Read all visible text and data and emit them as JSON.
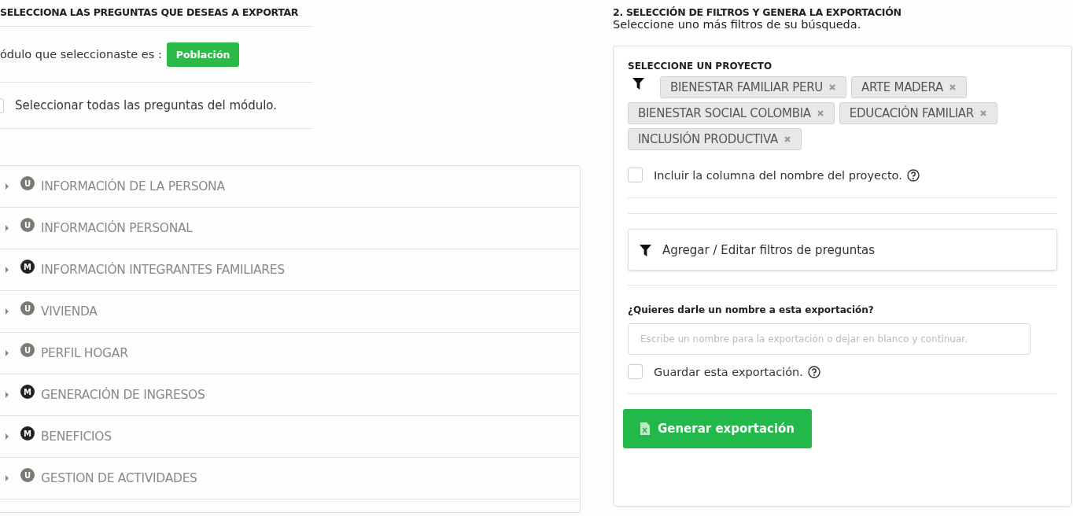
{
  "left": {
    "heading": "SELECCIONA LAS PREGUNTAS QUE DESEAS A EXPORTAR",
    "module_label": "ódulo que seleccionaste es :",
    "module_badge": "Población",
    "select_all": {
      "label": "Seleccionar todas las preguntas del módulo.",
      "checked": false
    },
    "sections": [
      {
        "badge": "U",
        "color": "#7a7a72",
        "title": "INFORMACIÓN DE LA PERSONA",
        "expanded": false
      },
      {
        "badge": "U",
        "color": "#7a7a72",
        "title": "INFORMACIÓN PERSONAL",
        "expanded": false
      },
      {
        "badge": "M",
        "color": "#222222",
        "title": "INFORMACIÓN INTEGRANTES FAMILIARES",
        "expanded": false
      },
      {
        "badge": "U",
        "color": "#7a7a72",
        "title": "VIVIENDA",
        "expanded": false
      },
      {
        "badge": "U",
        "color": "#7a7a72",
        "title": "PERFIL HOGAR",
        "expanded": false
      },
      {
        "badge": "M",
        "color": "#222222",
        "title": "GENERACIÓN DE INGRESOS",
        "expanded": false
      },
      {
        "badge": "M",
        "color": "#222222",
        "title": "BENEFICIOS",
        "expanded": false
      },
      {
        "badge": "U",
        "color": "#7a7a72",
        "title": "GESTION DE ACTIVIDADES",
        "expanded": false
      }
    ]
  },
  "right": {
    "heading": "2. SELECCIÓN DE FILTROS Y GENERA LA EXPORTACIÓN",
    "subheading": "Seleccione uno más filtros de su búsqueda.",
    "project_label": "SELECCIONE UN PROYECTO",
    "projects": [
      "BIENESTAR FAMILIAR PERU",
      "ARTE MADERA",
      "BIENESTAR SOCIAL COLOMBIA",
      "EDUCACIÓN FAMILIAR",
      "INCLUSIÓN PRODUCTIVA"
    ],
    "include_column": {
      "label": "Incluir la columna del nombre del proyecto.",
      "checked": false
    },
    "filters_button": "Agregar / Editar filtros de preguntas",
    "name_label": "¿Quieres darle un nombre a esta exportación?",
    "name_field": {
      "placeholder": "Escribe un nombre para la exportación o dejar en blanco y continuar."
    },
    "save": {
      "label": "Guardar esta exportación.",
      "checked": false
    },
    "generate_button": "Generar exportación"
  }
}
